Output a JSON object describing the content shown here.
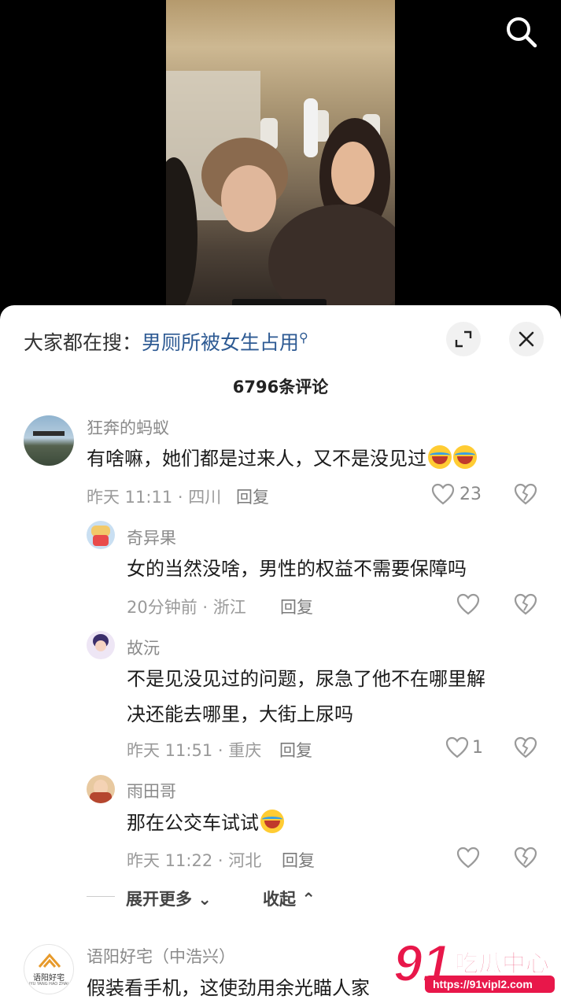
{
  "search_suggestion": {
    "prefix": "大家都在搜：",
    "term": "男厕所被女生占用"
  },
  "comment_count": "6796条评论",
  "comments": [
    {
      "user": "狂奔的蚂蚁",
      "text": "有啥嘛，她们都是过来人，又不是没见过",
      "emojis": 2,
      "meta": "昨天 11:11 · 四川",
      "reply": "回复",
      "likes": "23"
    },
    {
      "user": "奇异果",
      "text": "女的当然没啥，男性的权益不需要保障吗",
      "meta": "20分钟前 · 浙江",
      "reply": "回复",
      "likes": ""
    },
    {
      "user": "故沅",
      "text_line1": "不是见没见过的问题，尿急了他不在哪里解",
      "text_line2": "决还能去哪里，大街上尿吗",
      "meta": "昨天 11:51 · 重庆",
      "reply": "回复",
      "likes": "1"
    },
    {
      "user": "雨田哥",
      "text": "那在公交车试试",
      "emojis": 1,
      "meta": "昨天 11:22 · 河北",
      "reply": "回复",
      "likes": ""
    },
    {
      "user": "语阳好宅（中浩兴）",
      "text": "假装看手机，这使劲用余光瞄人家"
    }
  ],
  "thread_controls": {
    "expand": "展开更多",
    "collapse": "收起"
  },
  "avatar_logo": {
    "line1": "语阳好宅",
    "line2": "IYU YANG HAO ZHAI"
  },
  "watermark": {
    "number": "91",
    "name": "吃瓜中心",
    "url": "https://91vipl2.com"
  },
  "icons": {
    "search": "search-icon",
    "expand": "expand-icon",
    "close": "close-icon",
    "like": "heart-icon",
    "dislike": "broken-heart-icon"
  },
  "colors": {
    "link": "#2d5a93",
    "watermark": "#e8174a"
  }
}
